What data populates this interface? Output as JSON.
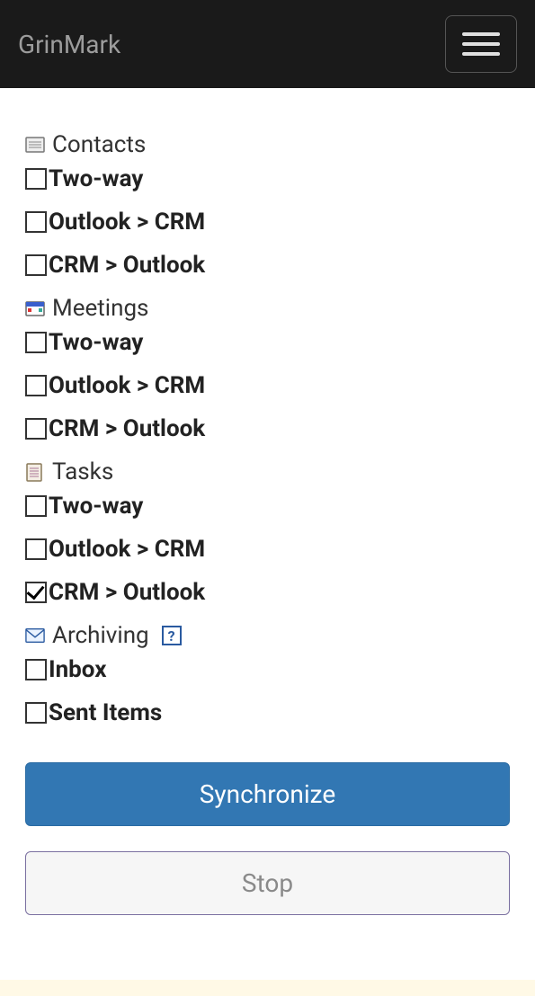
{
  "brand": "GrinMark",
  "sections": {
    "contacts": {
      "label": "Contacts",
      "options": [
        {
          "label": "Two-way",
          "checked": false
        },
        {
          "label": "Outlook > CRM",
          "checked": false
        },
        {
          "label": "CRM > Outlook",
          "checked": false
        }
      ]
    },
    "meetings": {
      "label": "Meetings",
      "options": [
        {
          "label": "Two-way",
          "checked": false
        },
        {
          "label": "Outlook > CRM",
          "checked": false
        },
        {
          "label": "CRM > Outlook",
          "checked": false
        }
      ]
    },
    "tasks": {
      "label": "Tasks",
      "options": [
        {
          "label": "Two-way",
          "checked": false
        },
        {
          "label": "Outlook > CRM",
          "checked": false
        },
        {
          "label": "CRM > Outlook",
          "checked": true
        }
      ]
    },
    "archiving": {
      "label": "Archiving",
      "help": "?",
      "options": [
        {
          "label": "Inbox",
          "checked": false
        },
        {
          "label": "Sent Items",
          "checked": false
        }
      ]
    }
  },
  "buttons": {
    "synchronize": "Synchronize",
    "stop": "Stop"
  }
}
